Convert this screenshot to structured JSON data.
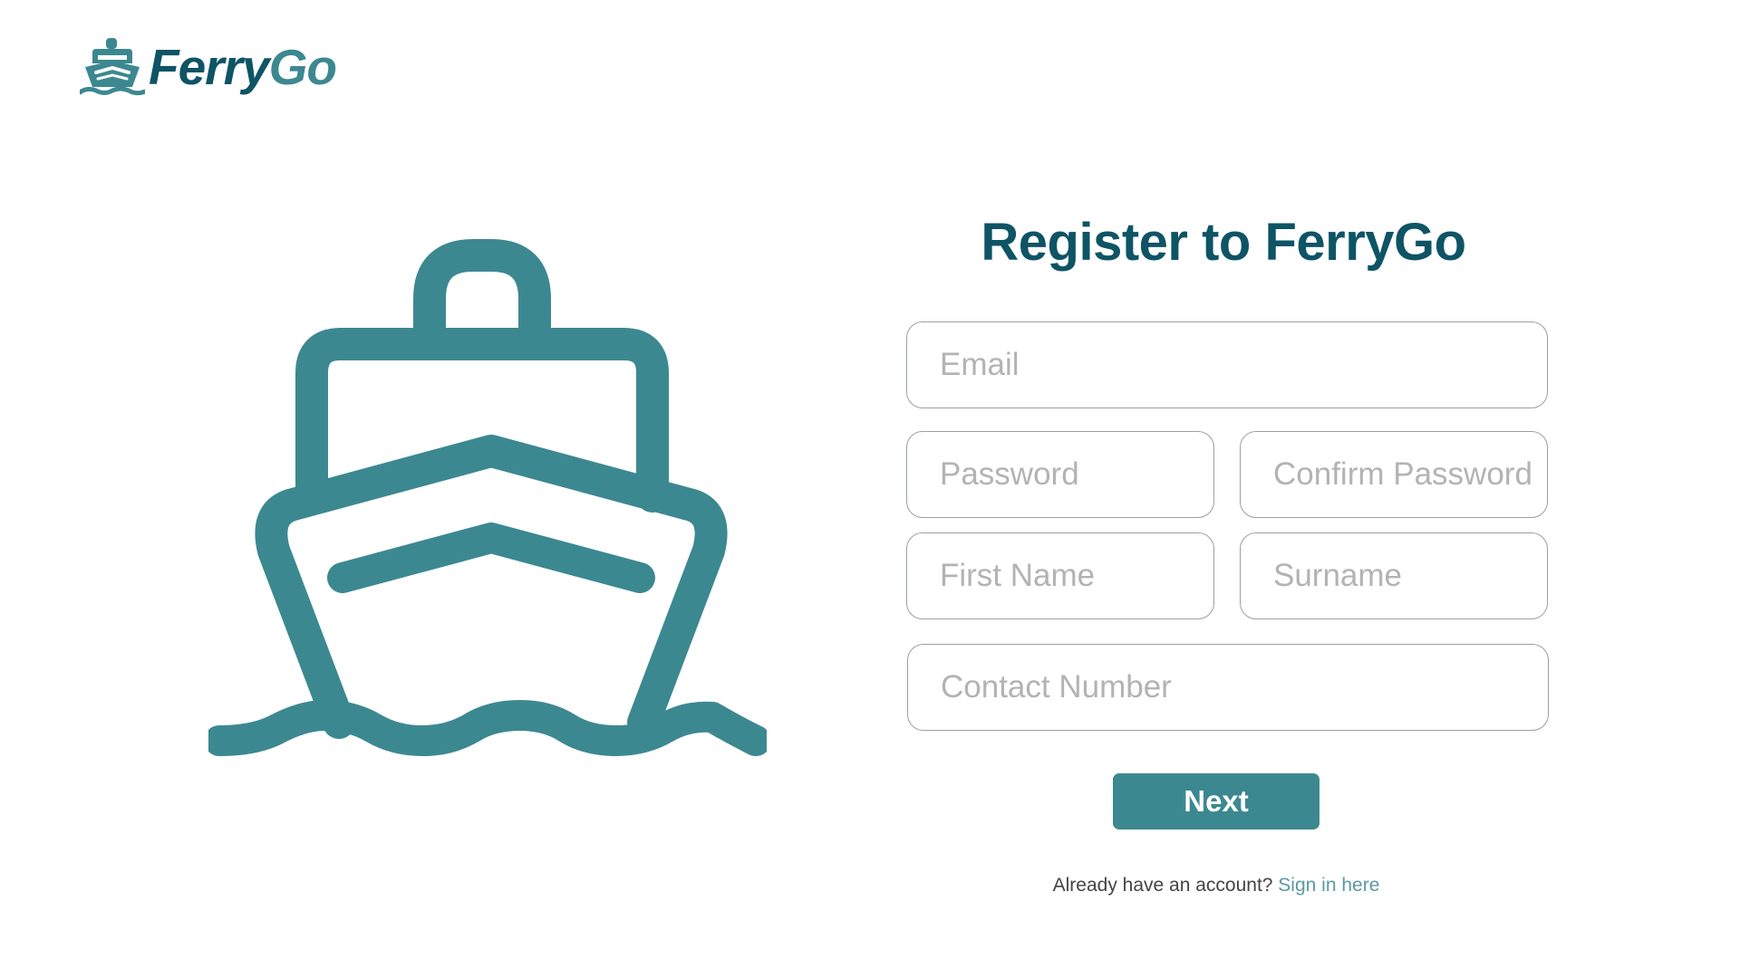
{
  "brand": {
    "name_part1": "Ferry",
    "name_part2": "Go",
    "primary_color": "#0e5465",
    "accent_color": "#3c8891"
  },
  "register": {
    "title": "Register to FerryGo",
    "fields": {
      "email_placeholder": "Email",
      "password_placeholder": "Password",
      "confirm_password_placeholder": "Confirm Password",
      "first_name_placeholder": "First Name",
      "surname_placeholder": "Surname",
      "contact_number_placeholder": "Contact Number"
    },
    "next_label": "Next",
    "signin_prompt": "Already have an account? ",
    "signin_link": "Sign in here"
  },
  "icons": {
    "logo": "ferry-boat-icon",
    "hero": "ferry-boat-illustration-icon"
  }
}
